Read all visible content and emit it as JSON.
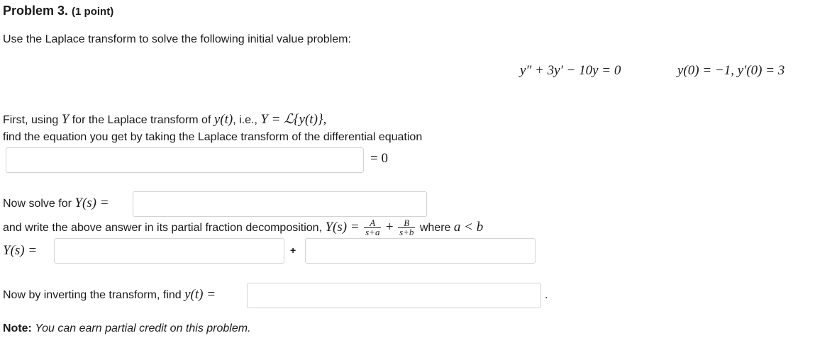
{
  "problem": {
    "title": "Problem 3.",
    "points": "(1 point)",
    "intro": "Use the Laplace transform to solve the following initial value problem:",
    "ode": "y″ + 3y′ − 10y = 0",
    "initial_conditions": "y(0) = −1,  y′(0) = 3"
  },
  "step1": {
    "line1_prefix": "First, using",
    "line1_Y": "Y",
    "line1_mid": "for the Laplace transform of",
    "line1_yt": "y(t)",
    "line1_ie": ", i.e.,",
    "line1_def": "Y = ℒ{y(t)},",
    "line2": "find the equation you get by taking the Laplace transform of the differential equation",
    "equals_zero": "= 0",
    "answer_value": ""
  },
  "step2": {
    "label": "Now solve for",
    "label_math": "Y(s) =",
    "answer_value": ""
  },
  "step3": {
    "text": "and write the above answer in its partial fraction decomposition,",
    "lhs": "Y(s) =",
    "frac1_num": "A",
    "frac1_den": "s+a",
    "plus": "+",
    "frac2_num": "B",
    "frac2_den": "s+b",
    "where": "where",
    "cond": "a < b",
    "Ys_label": "Y(s) =",
    "plus_between": "+",
    "answer1_value": "",
    "answer2_value": ""
  },
  "step4": {
    "label": "Now by inverting the transform, find",
    "label_math": "y(t) =",
    "period": ".",
    "answer_value": ""
  },
  "note": {
    "label": "Note:",
    "text": "You can earn partial credit on this problem."
  }
}
